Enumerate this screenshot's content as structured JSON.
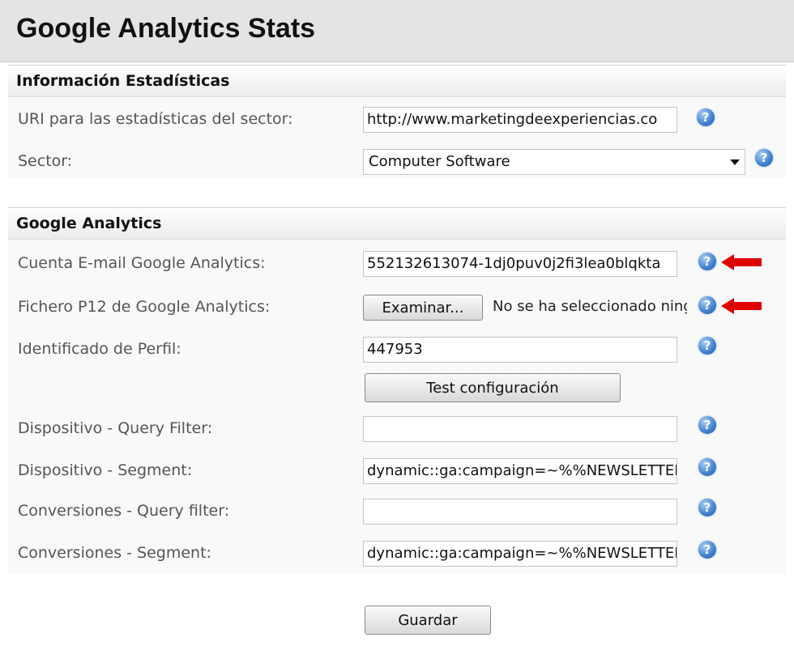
{
  "page": {
    "title": "Google Analytics Stats"
  },
  "stats_section": {
    "header": "Información Estadísticas",
    "uri": {
      "label": "URI para las estadísticas del sector:",
      "value": "http://www.marketingdeexperiencias.co"
    },
    "sector": {
      "label": "Sector:",
      "value": "Computer Software"
    }
  },
  "ga_section": {
    "header": "Google Analytics",
    "email": {
      "label": "Cuenta E-mail Google Analytics:",
      "value": "552132613074-1dj0puv0j2fi3lea0blqkta"
    },
    "p12": {
      "label": "Fichero P12 de Google Analytics:",
      "button": "Examinar...",
      "status": "No se ha seleccionado ningún archivo"
    },
    "profile": {
      "label": "Identificado de Perfil:",
      "value": "447953"
    },
    "test_button": "Test configuración",
    "device_filter": {
      "label": "Dispositivo - Query Filter:",
      "value": ""
    },
    "device_segment": {
      "label": "Dispositivo - Segment:",
      "value": "dynamic::ga:campaign=~%%NEWSLETTER"
    },
    "conv_filter": {
      "label": "Conversiones - Query filter:",
      "value": ""
    },
    "conv_segment": {
      "label": "Conversiones - Segment:",
      "value": "dynamic::ga:campaign=~%%NEWSLETTER"
    }
  },
  "save_button": "Guardar",
  "help_glyph": "?",
  "icons": {
    "help": "help-question-icon",
    "arrow": "red-left-arrow-icon"
  },
  "colors": {
    "help_blue": "#3f7fd0",
    "arrow_red": "#e00000"
  }
}
